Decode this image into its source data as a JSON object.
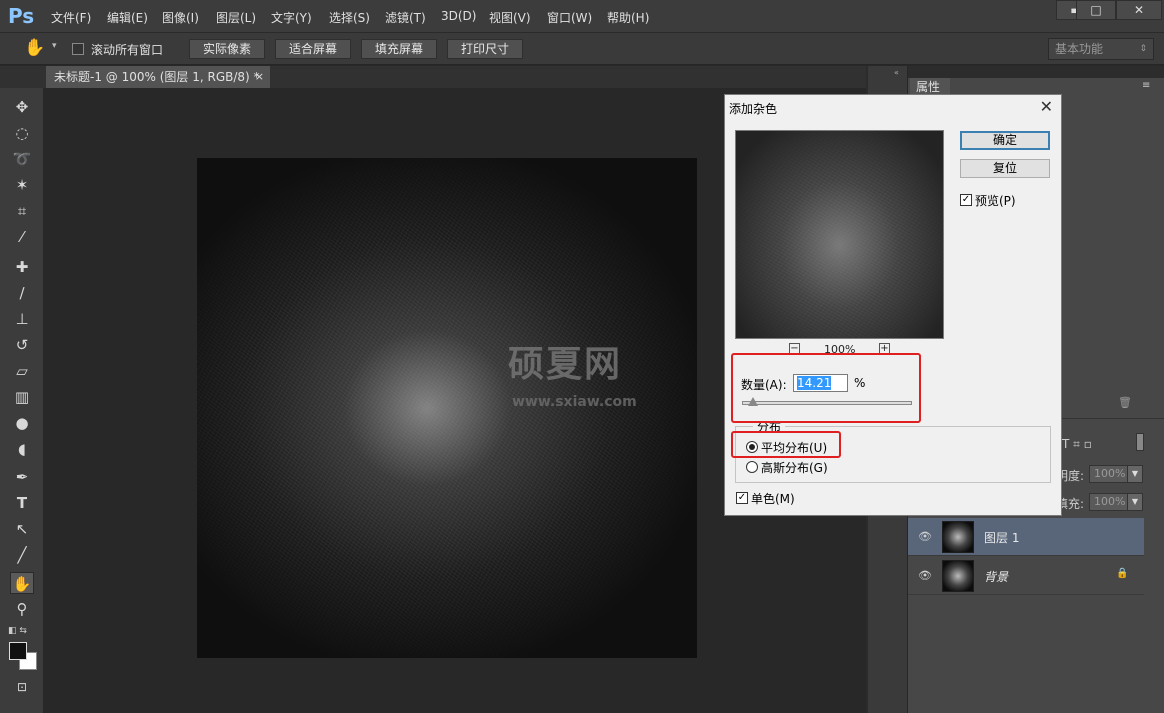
{
  "app": {
    "logo": "Ps",
    "menu": [
      "文件(F)",
      "编辑(E)",
      "图像(I)",
      "图层(L)",
      "文字(Y)",
      "选择(S)",
      "滤镜(T)",
      "3D(D)",
      "视图(V)",
      "窗口(W)",
      "帮助(H)"
    ],
    "window_controls": [
      "minimize-icon",
      "maximize-icon",
      "close-icon"
    ]
  },
  "options_bar": {
    "tool_icon": "hand-icon",
    "scroll_all_label": "滚动所有窗口",
    "buttons": [
      "实际像素",
      "适合屏幕",
      "填充屏幕",
      "打印尺寸"
    ],
    "workspace": "基本功能"
  },
  "document": {
    "tab_title": "未标题-1 @ 100% (图层 1, RGB/8) *",
    "tab_close": "×"
  },
  "watermark": {
    "text": "硕夏网",
    "url": "www.sxiaw.com"
  },
  "properties_panel": {
    "tab": "属性"
  },
  "layers_panel": {
    "opacity_label": "明度:",
    "opacity_value": "100%",
    "fill_label": "填充:",
    "fill_value": "100%",
    "layers": [
      {
        "name": "图层 1",
        "selected": true
      },
      {
        "name": "背景",
        "locked": true
      }
    ]
  },
  "dialog": {
    "title": "添加杂色",
    "ok": "确定",
    "reset": "复位",
    "preview_label": "预览(P)",
    "preview_checked": true,
    "zoom_minus": "−",
    "zoom_value": "100%",
    "zoom_plus": "+",
    "amount_label": "数量(A):",
    "amount_value": "14.21",
    "amount_unit": "%",
    "amount_fraction": 0.036,
    "distribution_label": "分布",
    "uniform_label": "平均分布(U)",
    "gaussian_label": "高斯分布(G)",
    "selected_distribution": "uniform",
    "monochromatic_label": "单色(M)",
    "monochromatic_checked": true
  },
  "colors": {
    "highlight": "#e02020",
    "selection": "#3399ff",
    "ps_blue": "#8cc6ff"
  }
}
